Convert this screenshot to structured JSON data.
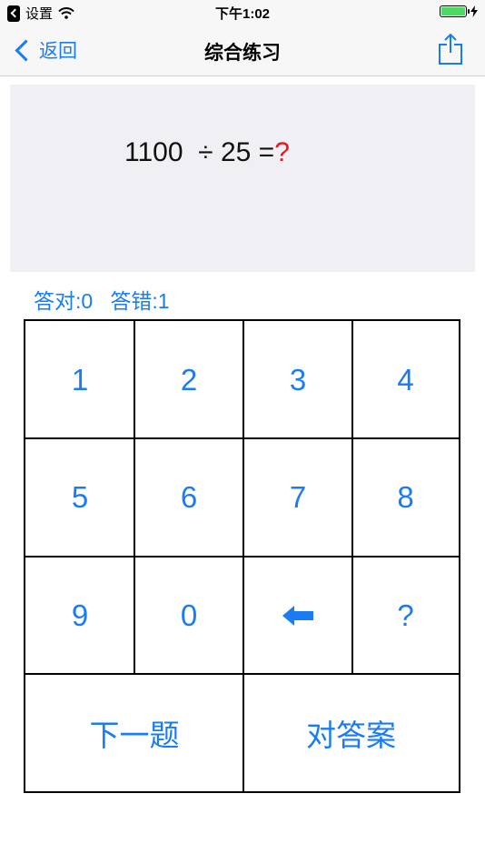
{
  "status_bar": {
    "back_label": "设置",
    "time": "下午1:02"
  },
  "nav": {
    "back_label": "返回",
    "title": "综合练习",
    "share_icon": "share-icon"
  },
  "question": {
    "expression": "1100  ÷ 25 =",
    "unknown": "?"
  },
  "score": {
    "correct_label": "答对:0",
    "wrong_label": "答错:1"
  },
  "keypad": {
    "k1": "1",
    "k2": "2",
    "k3": "3",
    "k4": "4",
    "k5": "5",
    "k6": "6",
    "k7": "7",
    "k8": "8",
    "k9": "9",
    "k0": "0",
    "backspace_icon": "left-arrow-icon",
    "kq": "?",
    "next_label": "下一题",
    "check_label": "对答案"
  },
  "colors": {
    "accent": "#1a7cf5",
    "unknown_mark": "#e5171d",
    "panel": "#efeff4"
  }
}
